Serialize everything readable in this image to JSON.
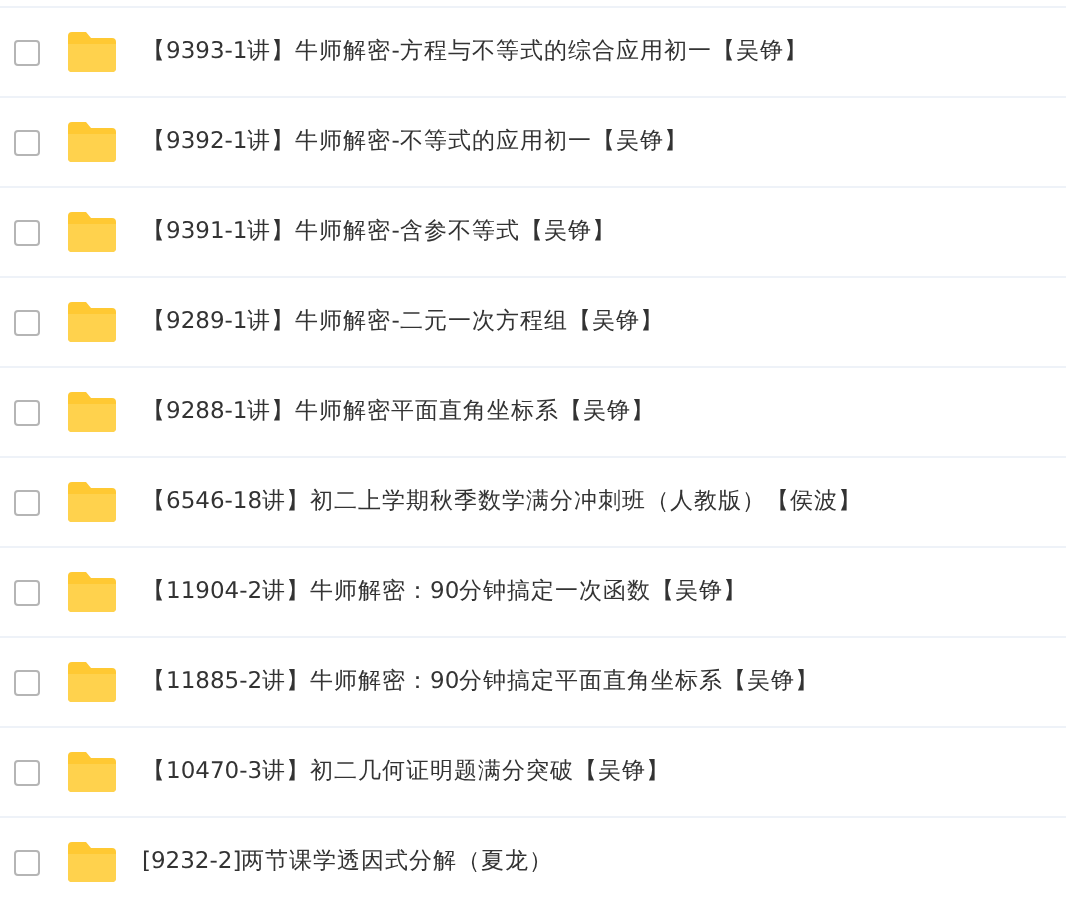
{
  "files": [
    {
      "name": "【9393-1讲】牛师解密-方程与不等式的综合应用初一【吴铮】",
      "checked": false
    },
    {
      "name": "【9392-1讲】牛师解密-不等式的应用初一【吴铮】",
      "checked": false
    },
    {
      "name": "【9391-1讲】牛师解密-含参不等式【吴铮】",
      "checked": false
    },
    {
      "name": "【9289-1讲】牛师解密-二元一次方程组【吴铮】",
      "checked": false
    },
    {
      "name": "【9288-1讲】牛师解密平面直角坐标系【吴铮】",
      "checked": false
    },
    {
      "name": "【6546-18讲】初二上学期秋季数学满分冲刺班（人教版）【侯波】",
      "checked": false
    },
    {
      "name": "【11904-2讲】牛师解密：90分钟搞定一次函数【吴铮】",
      "checked": false
    },
    {
      "name": "【11885-2讲】牛师解密：90分钟搞定平面直角坐标系【吴铮】",
      "checked": false
    },
    {
      "name": "【10470-3讲】初二几何证明题满分突破【吴铮】",
      "checked": false
    },
    {
      "name": "[9232-2]两节课学透因式分解（夏龙）",
      "checked": false
    }
  ]
}
